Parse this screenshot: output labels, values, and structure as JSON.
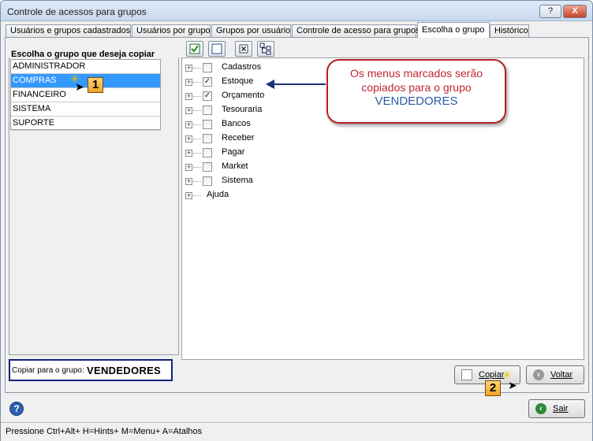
{
  "window": {
    "title": "Controle de acessos para grupos",
    "help_button": "?",
    "close_button": "X"
  },
  "tabs": [
    {
      "label": "Usuários e grupos cadastrados"
    },
    {
      "label": "Usuários por grupo"
    },
    {
      "label": "Grupos por usuário"
    },
    {
      "label": "Controle de acesso para grupos"
    },
    {
      "label": "Escolha o grupo",
      "active": true
    },
    {
      "label": "Histórico"
    }
  ],
  "left": {
    "heading": "Escolha o grupo que deseja copiar",
    "groups": [
      {
        "label": "ADMINISTRADOR"
      },
      {
        "label": "COMPRAS",
        "selected": true
      },
      {
        "label": "FINANCEIRO"
      },
      {
        "label": "SISTEMA"
      },
      {
        "label": "SUPORTE"
      }
    ]
  },
  "icons": {
    "check_all": "check-all-icon",
    "uncheck_all": "uncheck-all-icon",
    "collapse": "collapse-icon",
    "expand": "expand-tree-icon"
  },
  "tree": [
    {
      "label": "Cadastros",
      "checked": false,
      "has_checkbox": true
    },
    {
      "label": "Estoque",
      "checked": true,
      "has_checkbox": true
    },
    {
      "label": "Orçamento",
      "checked": true,
      "has_checkbox": true
    },
    {
      "label": "Tesouraria",
      "checked": false,
      "has_checkbox": true
    },
    {
      "label": "Bancos",
      "checked": false,
      "has_checkbox": true
    },
    {
      "label": "Receber",
      "checked": false,
      "has_checkbox": true
    },
    {
      "label": "Pagar",
      "checked": false,
      "has_checkbox": true
    },
    {
      "label": "Market",
      "checked": false,
      "has_checkbox": true
    },
    {
      "label": "Sistema",
      "checked": false,
      "has_checkbox": true
    },
    {
      "label": "Ajuda",
      "checked": false,
      "has_checkbox": false
    }
  ],
  "callout": {
    "line1": "Os menus marcados serão",
    "line2": "copiados para o grupo",
    "line3": "VENDEDORES"
  },
  "copy_to": {
    "label": "Copiar para o grupo:",
    "value": "VENDEDORES"
  },
  "buttons": {
    "copiar": "Copiar",
    "voltar": "Voltar",
    "sair": "Sair"
  },
  "badges": {
    "step1": "1",
    "step2": "2"
  },
  "statusbar": {
    "text": "Pressione Ctrl+Alt+ H=Hints+ M=Menu+ A=Atalhos"
  }
}
